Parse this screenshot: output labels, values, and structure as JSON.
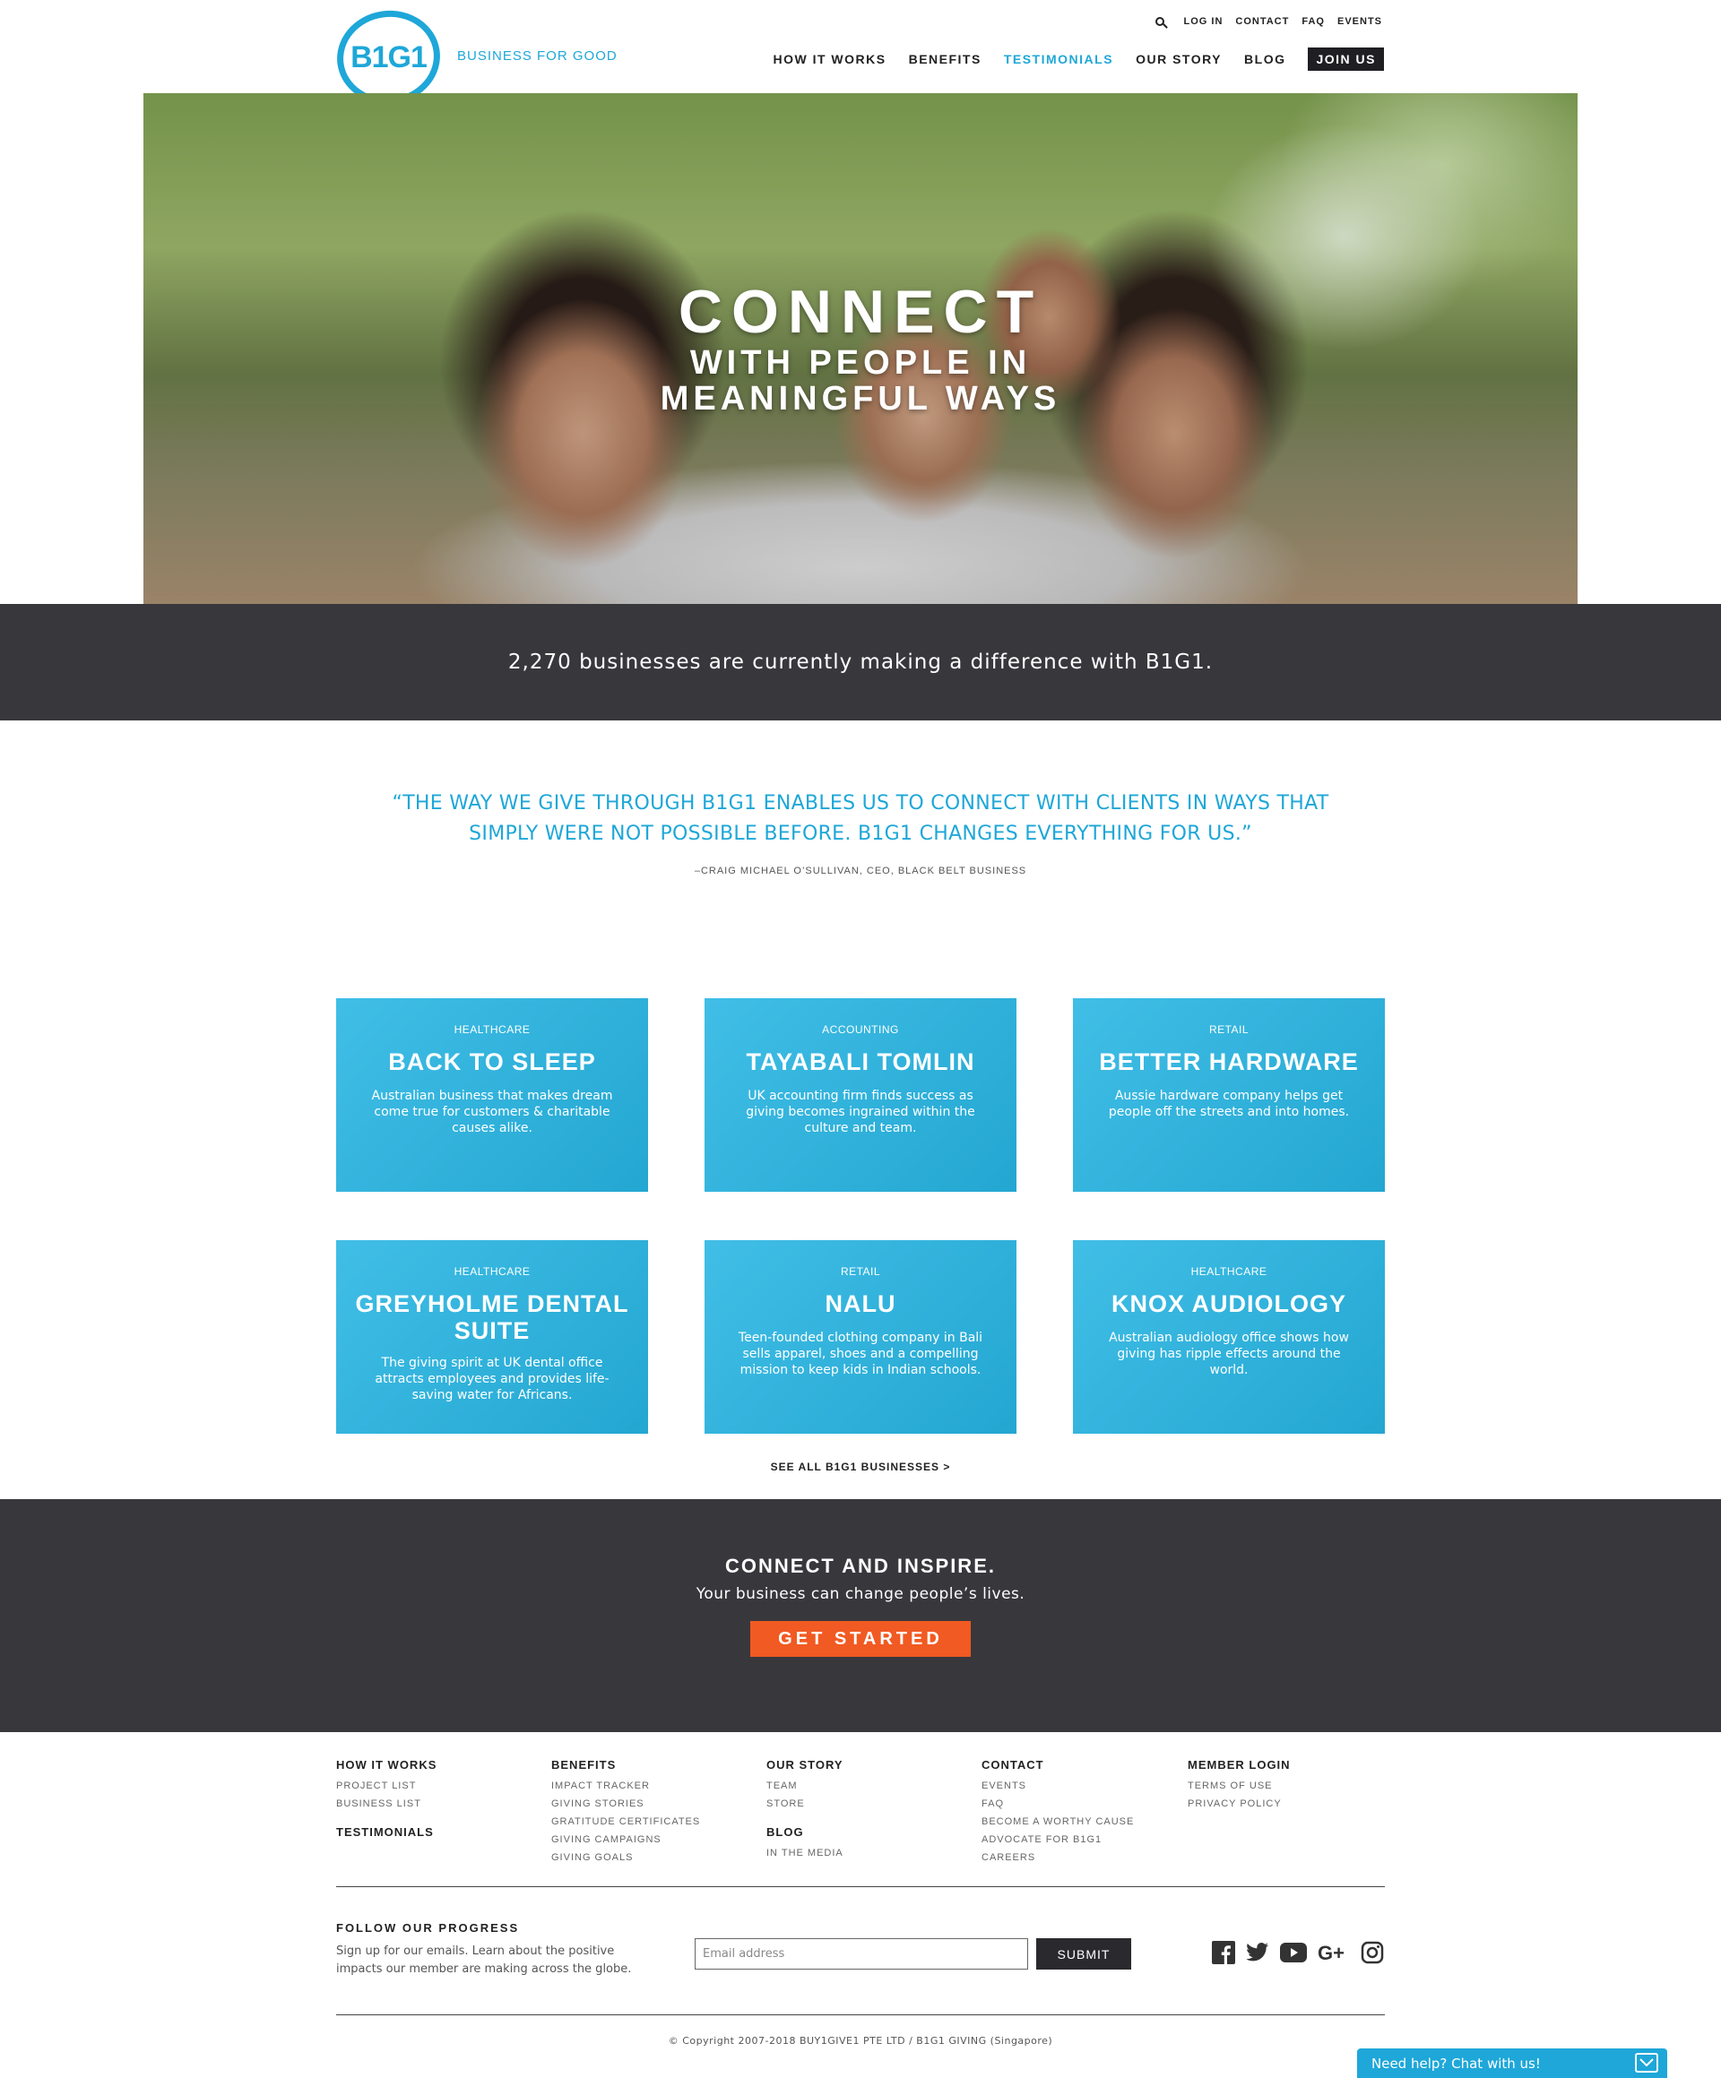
{
  "header": {
    "logo_text": "B1G1",
    "tagline": "BUSINESS FOR GOOD",
    "util_nav": [
      "LOG IN",
      "CONTACT",
      "FAQ",
      "EVENTS"
    ],
    "main_nav": [
      "HOW IT WORKS",
      "BENEFITS",
      "TESTIMONIALS",
      "OUR STORY",
      "BLOG"
    ],
    "join_label": "JOIN US",
    "active_nav": "TESTIMONIALS"
  },
  "hero": {
    "line1": "CONNECT",
    "line2": "WITH PEOPLE IN",
    "line3": "MEANINGFUL WAYS"
  },
  "stats": {
    "text": "2,270 businesses are currently making a difference with B1G1."
  },
  "quote": {
    "text": "“THE WAY WE GIVE THROUGH B1G1 ENABLES US TO CONNECT WITH CLIENTS IN WAYS THAT SIMPLY WERE NOT POSSIBLE BEFORE. B1G1 CHANGES EVERYTHING FOR US.”",
    "attribution": "–CRAIG MICHAEL O’SULLIVAN, CEO, BLACK BELT BUSINESS"
  },
  "cards": [
    {
      "category": "HEALTHCARE",
      "title": "BACK TO SLEEP",
      "desc": "Australian business that makes dream come true for customers & charitable causes alike."
    },
    {
      "category": "ACCOUNTING",
      "title": "TAYABALI TOMLIN",
      "desc": "UK accounting firm finds success as giving becomes ingrained within the culture and team."
    },
    {
      "category": "RETAIL",
      "title": "BETTER HARDWARE",
      "desc": "Aussie hardware company helps get people off the streets and into homes."
    },
    {
      "category": "HEALTHCARE",
      "title": "GREYHOLME DENTAL SUITE",
      "desc": "The giving spirit at UK dental office attracts employees and provides life-saving water for Africans."
    },
    {
      "category": "RETAIL",
      "title": "NALU",
      "desc": "Teen-founded clothing company in Bali sells apparel, shoes and a compelling mission to keep kids in Indian schools."
    },
    {
      "category": "HEALTHCARE",
      "title": "KNOX AUDIOLOGY",
      "desc": "Australian audiology office shows how giving has ripple effects around the world."
    }
  ],
  "see_all": "SEE ALL B1G1 BUSINESSES >",
  "cta": {
    "title": "CONNECT AND INSPIRE.",
    "subtitle": "Your business can change people’s lives.",
    "button": "GET STARTED"
  },
  "footer": {
    "col1": {
      "head": "HOW IT WORKS",
      "items": [
        "PROJECT LIST",
        "BUSINESS LIST"
      ],
      "head2": "TESTIMONIALS"
    },
    "col2": {
      "head": "BENEFITS",
      "items": [
        "IMPACT TRACKER",
        "GIVING STORIES",
        "GRATITUDE CERTIFICATES",
        "GIVING CAMPAIGNS",
        "GIVING GOALS"
      ]
    },
    "col3": {
      "head": "OUR STORY",
      "items": [
        "TEAM",
        "STORE"
      ],
      "head2": "BLOG",
      "items2": [
        "IN THE MEDIA"
      ]
    },
    "col4": {
      "head": "CONTACT",
      "items": [
        "EVENTS",
        "FAQ",
        "BECOME A WORTHY CAUSE",
        "ADVOCATE FOR B1G1",
        "CAREERS"
      ]
    },
    "col5": {
      "head": "MEMBER LOGIN",
      "items": [
        "TERMS OF USE",
        "PRIVACY POLICY"
      ]
    },
    "follow_title": "FOLLOW OUR PROGRESS",
    "follow_desc": "Sign up for our emails. Learn about the positive impacts our member are making across the globe.",
    "email_placeholder": "Email address",
    "submit_label": "SUBMIT",
    "socials": [
      "facebook-icon",
      "twitter-icon",
      "youtube-icon",
      "google-plus-icon",
      "instagram-icon"
    ],
    "copyright": "© Copyright 2007-2018 BUY1GIVE1 PTE LTD / B1G1 GIVING (Singapore)"
  },
  "chat": {
    "label": "Need help? Chat with us!"
  },
  "colors": {
    "brand": "#1ea7d8",
    "dark": "#38383c",
    "cta": "#f15a22",
    "card": "#26b5e3"
  }
}
